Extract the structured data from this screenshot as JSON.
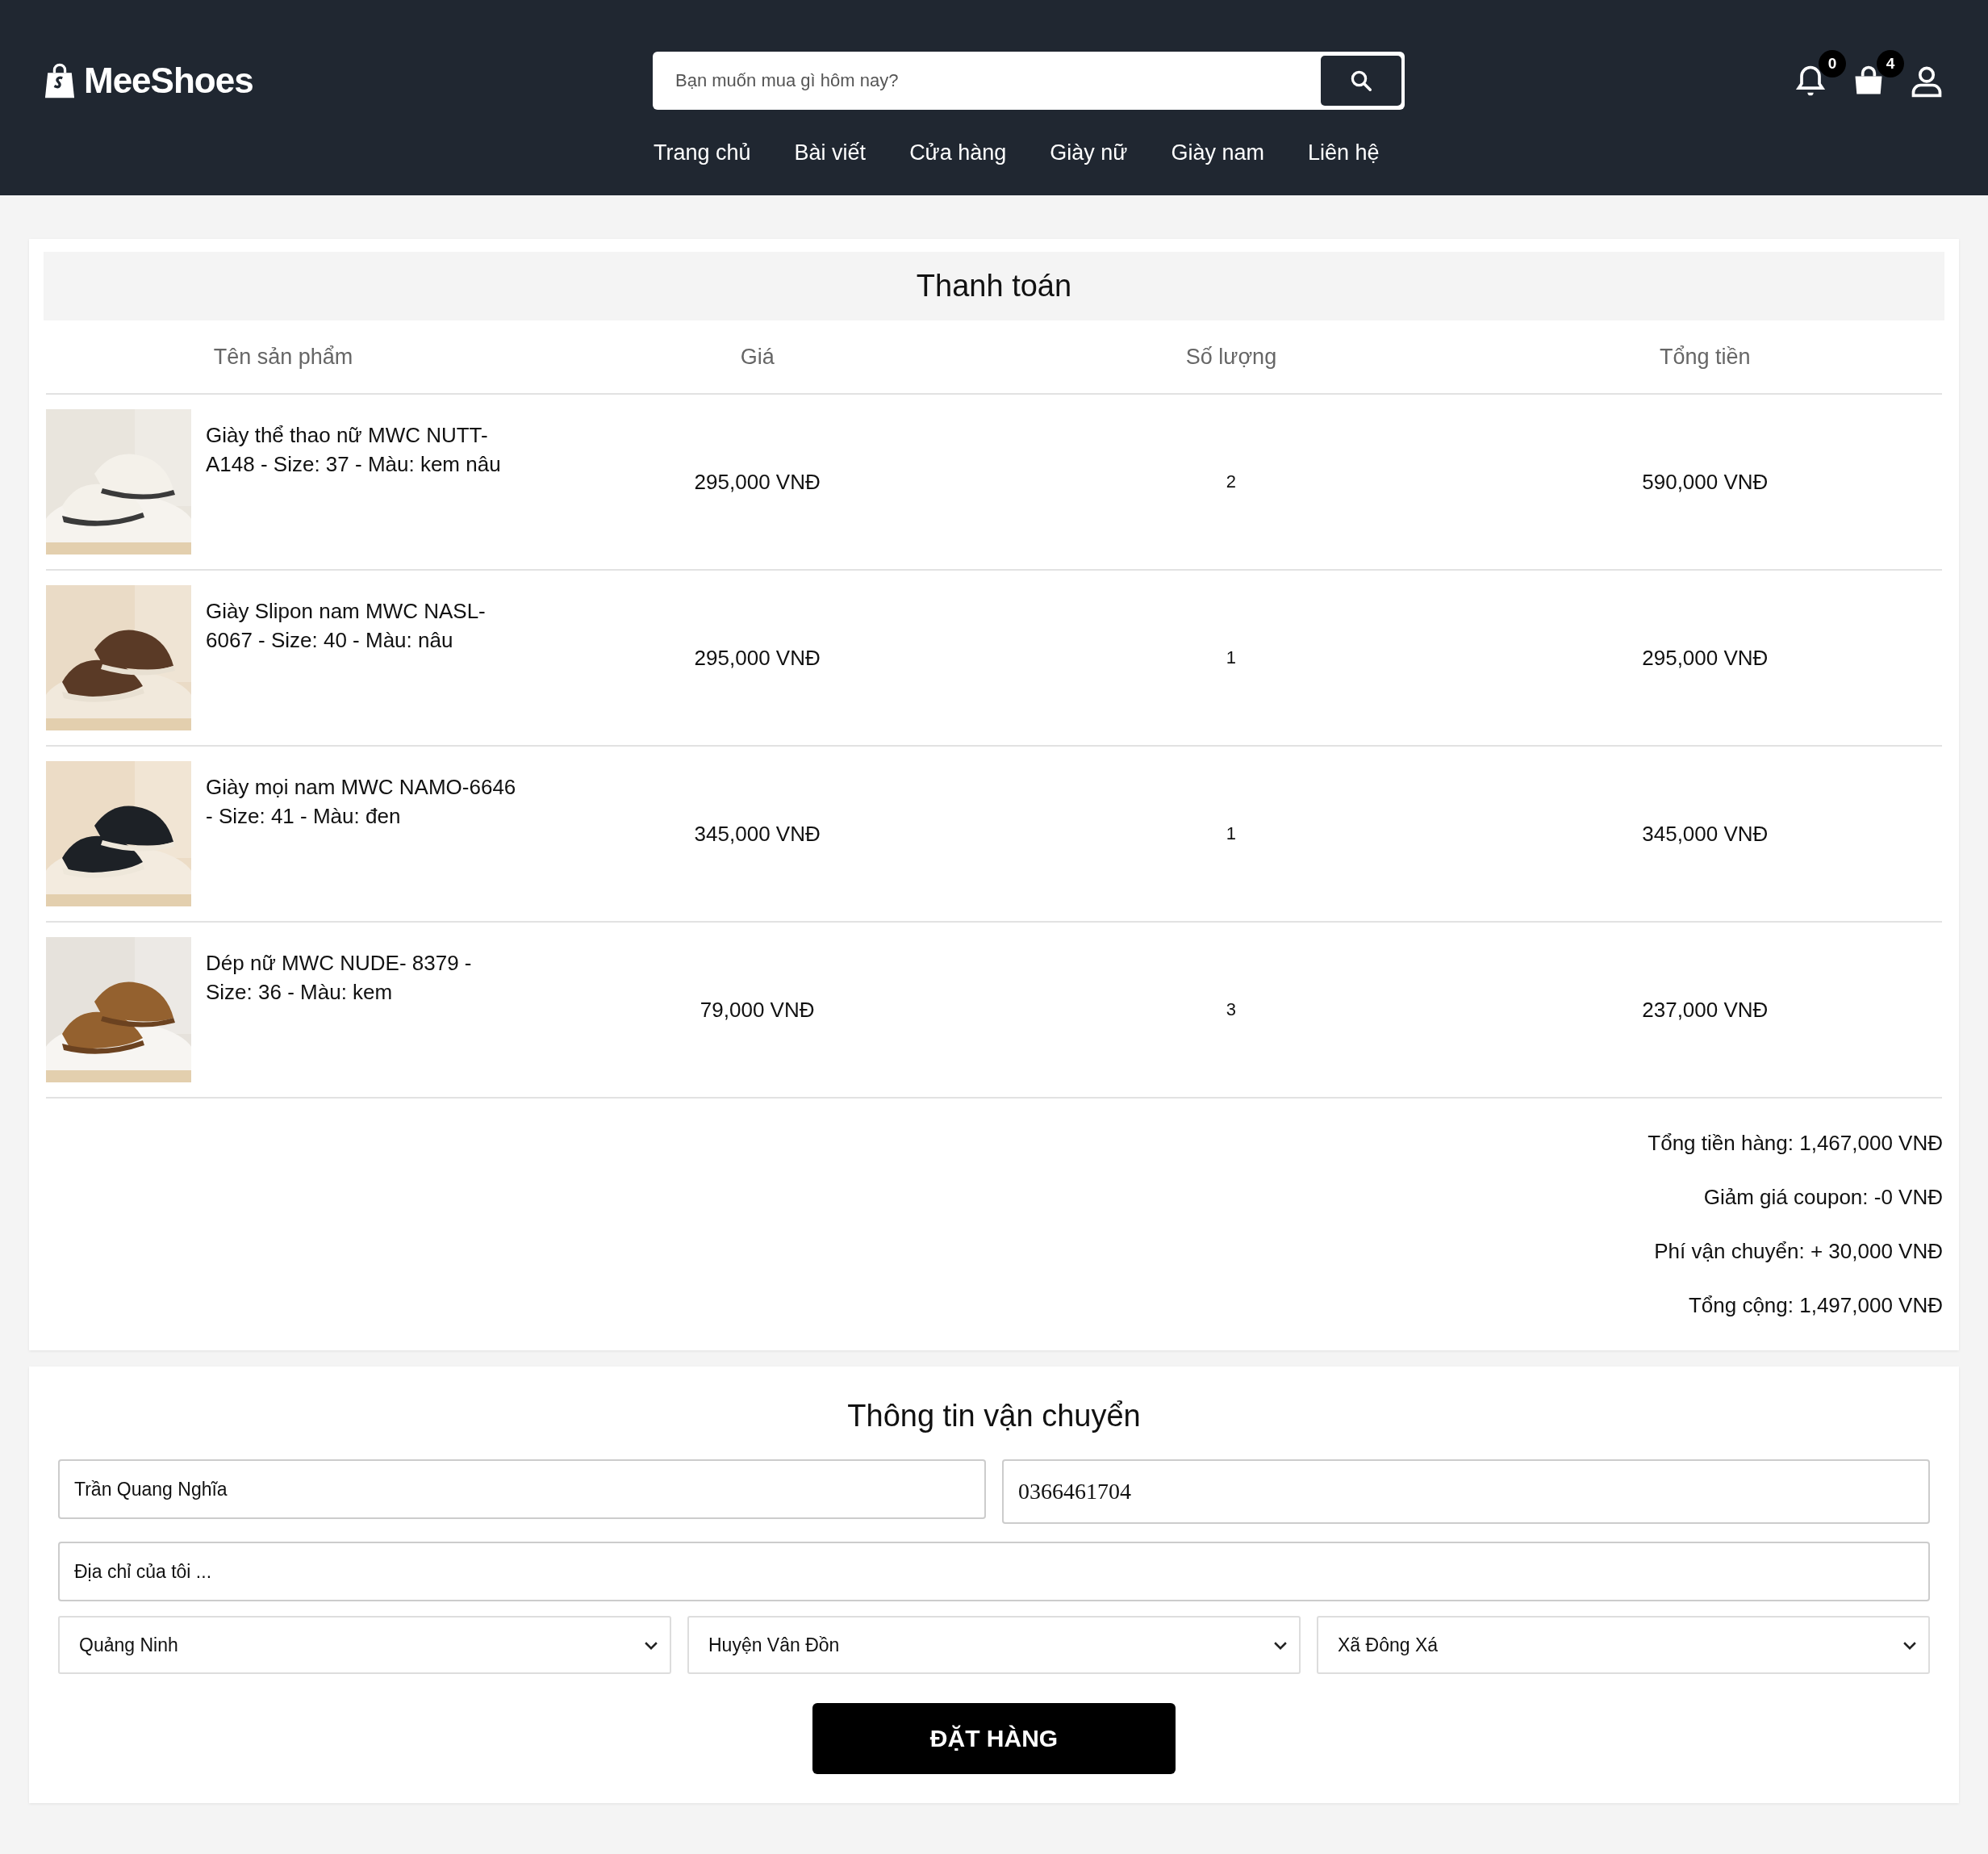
{
  "header": {
    "logo": "MeeShoes",
    "search": {
      "placeholder": "Bạn muốn mua gì hôm nay?"
    },
    "nav": [
      "Trang chủ",
      "Bài viết",
      "Cửa hàng",
      "Giày nữ",
      "Giày nam",
      "Liên hệ"
    ],
    "notifications_count": "0",
    "cart_count": "4"
  },
  "checkout": {
    "title": "Thanh toán",
    "columns": [
      "Tên sản phẩm",
      "Giá",
      "Số lượng",
      "Tổng tiền"
    ],
    "rows": [
      {
        "name": "Giày thể thao nữ MWC NUTT-A148 - Size: 37 - Màu: kem nâu",
        "price": "295,000 VNĐ",
        "quantity": "2",
        "total": "590,000 VNĐ"
      },
      {
        "name": "Giày Slipon nam MWC NASL-6067 - Size: 40 - Màu: nâu",
        "price": "295,000 VNĐ",
        "quantity": "1",
        "total": "295,000 VNĐ"
      },
      {
        "name": "Giày mọi nam MWC NAMO-6646 - Size: 41 - Màu: đen",
        "price": "345,000 VNĐ",
        "quantity": "1",
        "total": "345,000 VNĐ"
      },
      {
        "name": "Dép nữ MWC NUDE- 8379 - Size: 36 - Màu: kem",
        "price": "79,000 VNĐ",
        "quantity": "3",
        "total": "237,000 VNĐ"
      }
    ],
    "summary": [
      "Tổng tiền hàng: 1,467,000 VNĐ",
      "Giảm giá coupon: -0 VNĐ",
      "Phí vận chuyển: + 30,000 VNĐ",
      "Tổng cộng: 1,497,000 VNĐ"
    ]
  },
  "shipping": {
    "title": "Thông tin vận chuyển",
    "name": "Trần Quang Nghĩa",
    "phone": "0366461704",
    "address": "Địa chỉ của tôi ...",
    "province": "Quảng Ninh",
    "district": "Huyện Vân Đồn",
    "ward": "Xã Đông Xá",
    "submit": "ĐẶT HÀNG"
  }
}
